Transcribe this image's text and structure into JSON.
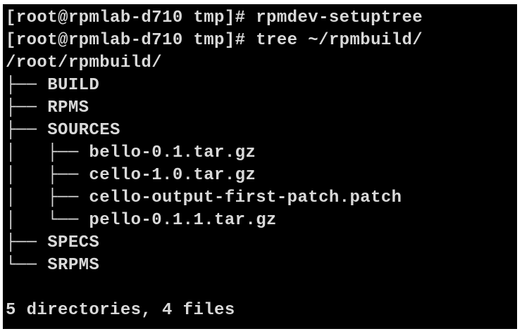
{
  "terminal": {
    "colors": {
      "background": "#000000",
      "text": "#d9d9d9",
      "frame": "#ffffff"
    },
    "lines": [
      "[root@rpmlab-d710 tmp]# rpmdev-setuptree",
      "[root@rpmlab-d710 tmp]# tree ~/rpmbuild/",
      "/root/rpmbuild/",
      "├── BUILD",
      "├── RPMS",
      "├── SOURCES",
      "│   ├── bello-0.1.tar.gz",
      "│   ├── cello-1.0.tar.gz",
      "│   ├── cello-output-first-patch.patch",
      "│   └── pello-0.1.1.tar.gz",
      "├── SPECS",
      "└── SRPMS",
      "",
      "5 directories, 4 files"
    ]
  }
}
